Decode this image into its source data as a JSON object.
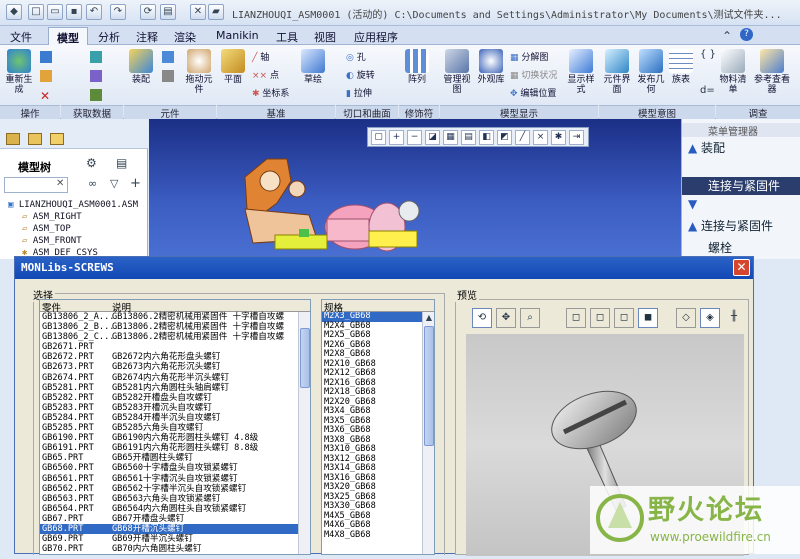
{
  "window": {
    "title": "LIANZHOUQI_ASM0001 (活动的) C:\\Documents and Settings\\Administrator\\My Documents\\测试文件夹..."
  },
  "menu": {
    "tabs": [
      "文件",
      "模型",
      "分析",
      "注释",
      "渲染",
      "Manikin",
      "工具",
      "视图",
      "应用程序"
    ],
    "active": "模型"
  },
  "ribbon": {
    "buttons": {
      "regen": "重新生成",
      "assemble": "装配",
      "drag": "拖动元件",
      "plane": "平面",
      "axis": "轴",
      "point": "点",
      "csys": "坐标系",
      "sketch": "草绘",
      "hole": "孔",
      "revolve": "旋转",
      "extrude": "拉伸",
      "pattern": "阵列",
      "manage_views": "管理视图",
      "appearance": "外观库",
      "exploded": "分解图",
      "toggle_state": "切换状况",
      "edit_position": "编辑位置",
      "display_style": "显示样式",
      "component_interface": "元件界面",
      "publish_geom": "发布几何",
      "table": "族表",
      "bom": "物料清单",
      "ref_viewer": "参考查看器"
    },
    "groups": [
      "操作",
      "获取数据",
      "元件",
      "基准",
      "切口和曲面",
      "修饰符",
      "模型显示",
      "模型意图",
      "调查"
    ]
  },
  "left_panel": {
    "title": "模型树",
    "tree": [
      "LIANZHOUQI_ASM0001.ASM",
      "ASM_RIGHT",
      "ASM_TOP",
      "ASM_FRONT",
      "ASM_DEF_CSYS"
    ]
  },
  "right_panel": {
    "title": "菜单管理器",
    "items": [
      "装配",
      "连接与紧固件",
      "连接与紧固件",
      "螺栓"
    ]
  },
  "dialog": {
    "title": "MONLibs-SCREWS",
    "select_label": "选择",
    "preview_label": "预览",
    "col_part": "零件",
    "col_desc": "说明",
    "col_spec": "规格",
    "parts": [
      [
        "GB13806_2_A...",
        "GB13806.2精密机械用紧固件   十字槽自攻螺"
      ],
      [
        "GB13806_2_B...",
        "GB13806.2精密机械用紧固件   十字槽自攻螺"
      ],
      [
        "GB13806_2_C...",
        "GB13806.2精密机械用紧固件   十字槽自攻螺"
      ],
      [
        "GB2671.PRT",
        ""
      ],
      [
        "GB2672.PRT",
        "GB2672内六角花形盘头螺钉"
      ],
      [
        "GB2673.PRT",
        "GB2673内六角花形沉头螺钉"
      ],
      [
        "GB2674.PRT",
        "GB2674内六角花形半沉头螺钉"
      ],
      [
        "GB5281.PRT",
        "GB5281内六角圆柱头轴肩螺钉"
      ],
      [
        "GB5282.PRT",
        "GB5282开槽盘头自攻螺钉"
      ],
      [
        "GB5283.PRT",
        "GB5283开槽沉头自攻螺钉"
      ],
      [
        "GB5284.PRT",
        "GB5284开槽半沉头自攻螺钉"
      ],
      [
        "GB5285.PRT",
        "GB5285六角头自攻螺钉"
      ],
      [
        "GB6190.PRT",
        "GB6190内六角花形圆柱头螺钉   4.8级"
      ],
      [
        "GB6191.PRT",
        "GB6191内六角花形圆柱头螺钉   8.8级"
      ],
      [
        "GB65.PRT",
        "GB65开槽圆柱头螺钉"
      ],
      [
        "GB6560.PRT",
        "GB6560十字槽盘头自攻锁紧螺钉"
      ],
      [
        "GB6561.PRT",
        "GB6561十字槽沉头自攻锁紧螺钉"
      ],
      [
        "GB6562.PRT",
        "GB6562十字槽半沉头自攻锁紧螺钉"
      ],
      [
        "GB6563.PRT",
        "GB6563六角头自攻锁紧螺钉"
      ],
      [
        "GB6564.PRT",
        "GB6564内六角圆柱头自攻锁紧螺钉"
      ],
      [
        "GB67.PRT",
        "GB67开槽盘头螺钉"
      ],
      [
        "GB68.PRT",
        "GB68开槽沉头螺钉"
      ],
      [
        "GB69.PRT",
        "GB69开槽半沉头螺钉"
      ],
      [
        "GB70.PRT",
        "GB70内六角圆柱头螺钉"
      ]
    ],
    "selected_part": "GB68.PRT",
    "specs": [
      "M2X3_GB68",
      "M2X4_GB68",
      "M2X5_GB68",
      "M2X6_GB68",
      "M2X8_GB68",
      "M2X10_GB68",
      "M2X12_GB68",
      "M2X16_GB68",
      "M2X18_GB68",
      "M2X20_GB68",
      "M3X4_GB68",
      "M3X5_GB68",
      "M3X6_GB68",
      "M3X8_GB68",
      "M3X10_GB68",
      "M3X12_GB68",
      "M3X14_GB68",
      "M3X16_GB68",
      "M3X20_GB68",
      "M3X25_GB68",
      "M3X30_GB68",
      "M4X5_GB68",
      "M4X6_GB68",
      "M4X8_GB68"
    ],
    "selected_spec": "M2X3_GB68"
  },
  "watermark": {
    "text": "野火论坛",
    "url": "www.proewildfire.cn"
  }
}
